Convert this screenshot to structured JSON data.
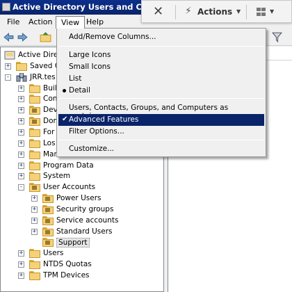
{
  "window": {
    "title": "Active Directory Users and Computers"
  },
  "menubar": {
    "file": "File",
    "action": "Action",
    "view": "View",
    "help": "Help"
  },
  "toolbar": {
    "icons": [
      "back-arrow-icon",
      "forward-arrow-icon",
      "up-folder-icon",
      "filter-icon"
    ]
  },
  "view_menu": {
    "items": [
      {
        "label": "Add/Remove Columns...",
        "mark": ""
      },
      {
        "label": "Large Icons",
        "mark": ""
      },
      {
        "label": "Small Icons",
        "mark": ""
      },
      {
        "label": "List",
        "mark": ""
      },
      {
        "label": "Detail",
        "mark": "bullet"
      },
      {
        "label": "Users, Contacts, Groups, and Computers as containers",
        "mark": ""
      },
      {
        "label": "Advanced Features",
        "mark": "check"
      },
      {
        "label": "Filter Options...",
        "mark": ""
      },
      {
        "label": "Customize...",
        "mark": ""
      }
    ],
    "highlighted": "Advanced Features"
  },
  "tree": {
    "nodes": [
      {
        "label": "Active Directo",
        "expander": "",
        "kind": "console"
      },
      {
        "label": "Saved Q",
        "expander": "+",
        "kind": "folder"
      },
      {
        "label": "JRR.tes",
        "expander": "-",
        "kind": "domain"
      },
      {
        "label": "Buil",
        "expander": "+",
        "kind": "folder"
      },
      {
        "label": "Con",
        "expander": "+",
        "kind": "folder"
      },
      {
        "label": "Dev",
        "expander": "+",
        "kind": "ou"
      },
      {
        "label": "Don",
        "expander": "+",
        "kind": "ou"
      },
      {
        "label": "For",
        "expander": "+",
        "kind": "folder"
      },
      {
        "label": "Los",
        "expander": "+",
        "kind": "folder"
      },
      {
        "label": "Mar",
        "expander": "+",
        "kind": "folder"
      },
      {
        "label": "Program Data",
        "expander": "+",
        "kind": "folder"
      },
      {
        "label": "System",
        "expander": "+",
        "kind": "folder"
      },
      {
        "label": "User Accounts",
        "expander": "-",
        "kind": "ou"
      },
      {
        "label": "Power Users",
        "expander": "+",
        "kind": "ou"
      },
      {
        "label": "Security groups",
        "expander": "+",
        "kind": "ou"
      },
      {
        "label": "Service accounts",
        "expander": "+",
        "kind": "ou"
      },
      {
        "label": "Standard Users",
        "expander": "+",
        "kind": "ou"
      },
      {
        "label": "Support",
        "expander": "",
        "kind": "ou"
      },
      {
        "label": "Users",
        "expander": "+",
        "kind": "folder"
      },
      {
        "label": "NTDS Quotas",
        "expander": "+",
        "kind": "folder"
      },
      {
        "label": "TPM Devices",
        "expander": "+",
        "kind": "folder"
      }
    ],
    "selected": "Support"
  },
  "action_bar": {
    "actions_label": "Actions",
    "icons": [
      "close-icon",
      "lightning-icon",
      "windows-icon"
    ]
  },
  "colors": {
    "highlight": "#0a246a",
    "titlebar": "#0a246a",
    "folder": "#f5d27a"
  }
}
